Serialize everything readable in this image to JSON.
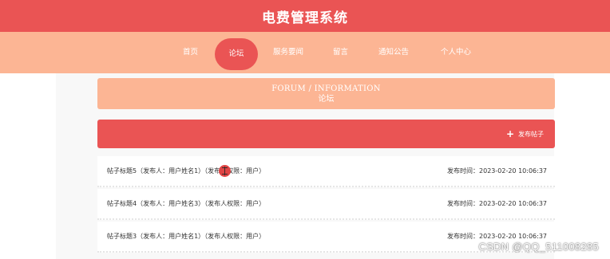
{
  "header": {
    "site_title": "电费管理系统"
  },
  "nav": {
    "items": [
      {
        "label": "首页"
      },
      {
        "label": "论坛"
      },
      {
        "label": "服务要闻"
      },
      {
        "label": "留言"
      },
      {
        "label": "通知公告"
      },
      {
        "label": "个人中心"
      }
    ],
    "active_index": 1
  },
  "banner": {
    "title_en": "FORUM / INFORMATION",
    "title_cn": "论坛"
  },
  "actions": {
    "post_button_label": "发布帖子",
    "post_button_icon": "plus-icon"
  },
  "posts": [
    {
      "title": "帖子标题5（发布人：用户姓名1）（发布人权限：用户）",
      "time": "发布时间：2023-02-20 10:06:37"
    },
    {
      "title": "帖子标题4（发布人：用户姓名3）（发布人权限：用户）",
      "time": "发布时间：2023-02-20 10:06:37"
    },
    {
      "title": "帖子标题3（发布人：用户姓名1）（发布人权限：用户）",
      "time": "发布时间：2023-02-20 10:06:37"
    }
  ],
  "watermark": "CSDN @QQ_511008285",
  "colors": {
    "primary": "#ea5454",
    "secondary": "#fcb594",
    "text": "#333333",
    "background": "#ffffff"
  }
}
